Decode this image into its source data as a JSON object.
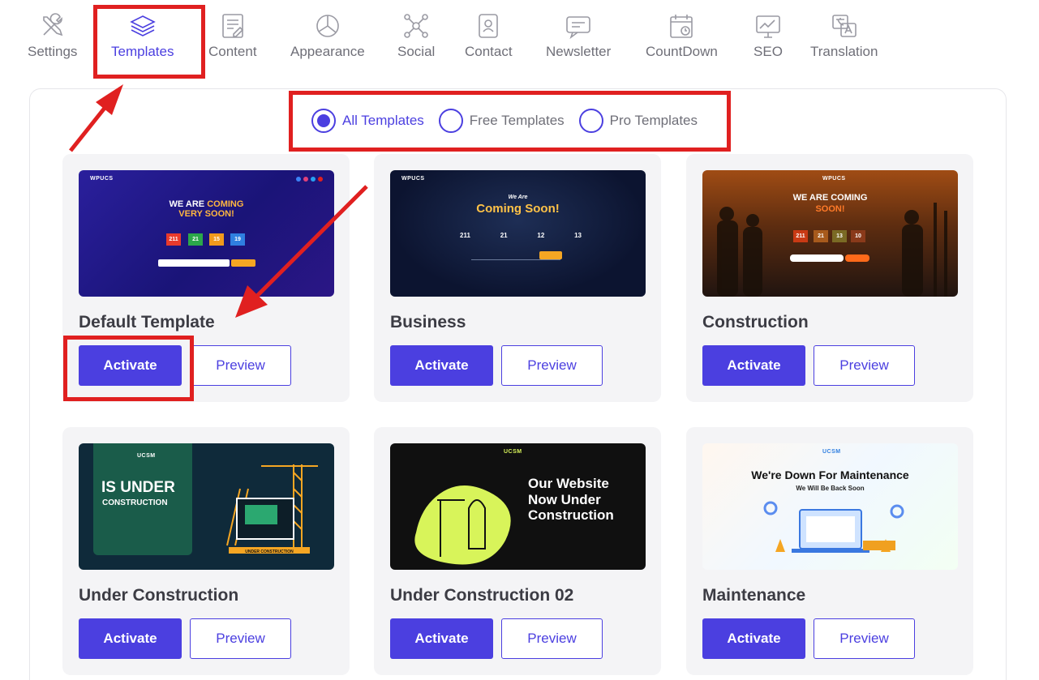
{
  "tabs": [
    {
      "label": "Settings",
      "icon": "settings-tools-icon"
    },
    {
      "label": "Templates",
      "icon": "layers-icon"
    },
    {
      "label": "Content",
      "icon": "content-edit-icon"
    },
    {
      "label": "Appearance",
      "icon": "pie-chart-icon"
    },
    {
      "label": "Social",
      "icon": "share-network-icon"
    },
    {
      "label": "Contact",
      "icon": "contact-book-icon"
    },
    {
      "label": "Newsletter",
      "icon": "message-icon"
    },
    {
      "label": "CountDown",
      "icon": "calendar-clock-icon"
    },
    {
      "label": "SEO",
      "icon": "seo-monitor-icon"
    },
    {
      "label": "Translation",
      "icon": "translate-icon"
    }
  ],
  "active_tab": "Templates",
  "filter": {
    "options": [
      "All Templates",
      "Free Templates",
      "Pro Templates"
    ],
    "selected": "All Templates"
  },
  "templates": [
    {
      "name": "Default Template",
      "activate_label": "Activate",
      "preview_label": "Preview",
      "thumb": {
        "logo": "WPUCS",
        "line1": "WE ARE",
        "line1b": "COMING",
        "line2": "VERY SOON!",
        "counts": [
          "211",
          "21",
          "15",
          "19"
        ]
      }
    },
    {
      "name": "Business",
      "activate_label": "Activate",
      "preview_label": "Preview",
      "thumb": {
        "logo": "WPUCS",
        "line1": "We Are",
        "line2": "Coming Soon!",
        "counts": [
          "211",
          "21",
          "12",
          "13"
        ]
      }
    },
    {
      "name": "Construction",
      "activate_label": "Activate",
      "preview_label": "Preview",
      "thumb": {
        "logo": "WPUCS",
        "line1": "WE ARE COMING",
        "line2": "SOON!",
        "counts": [
          "211",
          "21",
          "13",
          "10"
        ]
      }
    },
    {
      "name": "Under Construction",
      "activate_label": "Activate",
      "preview_label": "Preview",
      "thumb": {
        "logo": "UCSM",
        "line1": "IS UNDER",
        "line2": "CONSTRUCTION",
        "tape": "UNDER CONSTRUCTION"
      }
    },
    {
      "name": "Under Construction 02",
      "activate_label": "Activate",
      "preview_label": "Preview",
      "thumb": {
        "logo": "UCSM",
        "line1": "Our Website",
        "line2": "Now Under",
        "line3": "Construction"
      }
    },
    {
      "name": "Maintenance",
      "activate_label": "Activate",
      "preview_label": "Preview",
      "thumb": {
        "logo": "UCSM",
        "line1": "We're Down For Maintenance",
        "line2": "We Will Be Back Soon"
      }
    }
  ],
  "colors": {
    "accent": "#4b3fe0",
    "annotation": "#e02020",
    "card_bg": "#f4f4f6"
  }
}
